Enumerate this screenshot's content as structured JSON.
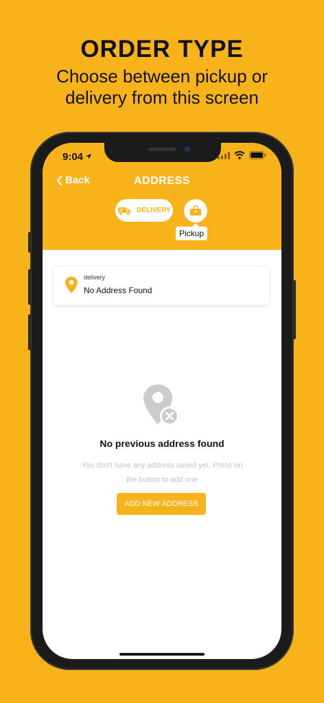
{
  "promo": {
    "title": "ORDER TYPE",
    "subtitle": "Choose between pickup or delivery from this screen"
  },
  "status_bar": {
    "time": "9:04",
    "icons": [
      "location-arrow-icon",
      "signal-icon",
      "wifi-icon",
      "battery-icon"
    ]
  },
  "nav": {
    "back_label": "Back",
    "title": "ADDRESS"
  },
  "order_type": {
    "delivery_label": "DELIVERY",
    "pickup_tooltip": "Pickup",
    "selected": "delivery"
  },
  "address_card": {
    "type": "delivery",
    "value": "No Address Found"
  },
  "empty_state": {
    "title": "No previous address found",
    "message": "You don't have any address saved yet. Press on the button to add one",
    "button": "ADD NEW ADDRESS"
  },
  "colors": {
    "accent": "#F8B31B",
    "text": "#111111",
    "muted": "#C4C4C4",
    "icon_gray": "#CCCCCC"
  }
}
